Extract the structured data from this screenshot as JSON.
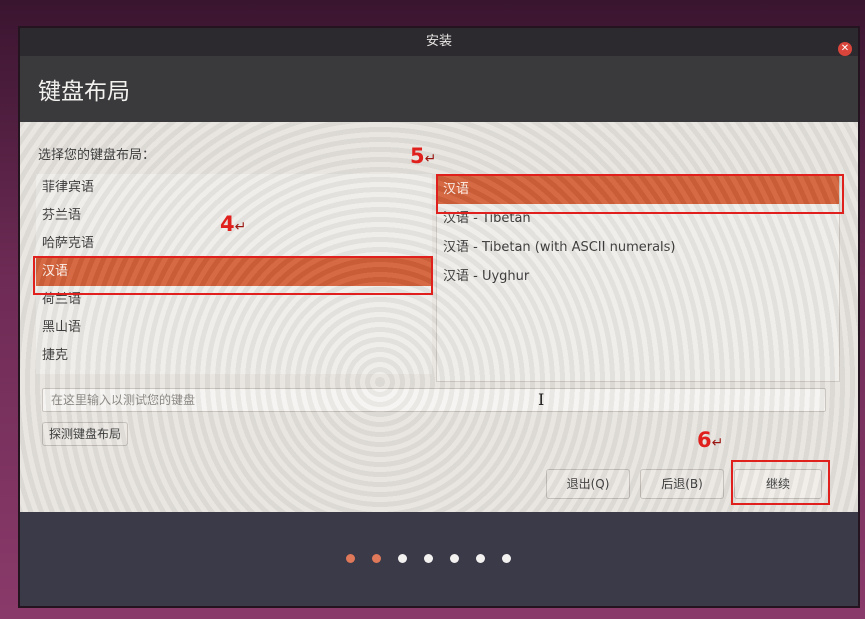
{
  "window": {
    "title": "安装",
    "close_icon": "close-icon"
  },
  "page": {
    "heading": "键盘布局",
    "prompt": "选择您的键盘布局："
  },
  "layouts": {
    "items": [
      "菲律宾语",
      "芬兰语",
      "哈萨克语",
      "汉语",
      "荷兰语",
      "黑山语",
      "捷克"
    ],
    "selected": "汉语"
  },
  "variants": {
    "items": [
      "汉语",
      "汉语 - Tibetan",
      "汉语 - Tibetan (with ASCII numerals)",
      "汉语 - Uyghur"
    ],
    "selected": "汉语"
  },
  "test_input": {
    "placeholder": "在这里输入以测试您的键盘",
    "value": ""
  },
  "buttons": {
    "detect": "探测键盘布局",
    "quit": "退出(Q)",
    "back": "后退(B)",
    "continue": "继续"
  },
  "progress": {
    "total_steps": 7,
    "completed_steps": 2
  },
  "annotations": {
    "step4": "4",
    "step5": "5",
    "step6": "6",
    "arrow": "↵",
    "highlight_color": "#e0201d"
  }
}
